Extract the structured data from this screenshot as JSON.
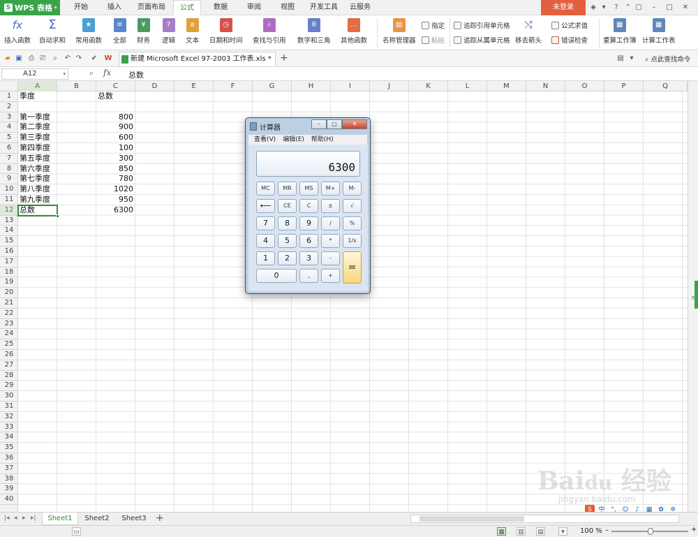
{
  "app": {
    "title": "WPS 表格",
    "login": "未登录"
  },
  "menu_tabs": [
    "开始",
    "插入",
    "页面布局",
    "公式",
    "数据",
    "审阅",
    "视图",
    "开发工具",
    "云服务"
  ],
  "ribbon": {
    "insert_function": "插入函数",
    "autosum": "自动求和",
    "common_func": "常用函数",
    "all": "全部",
    "finance": "财务",
    "logic": "逻辑",
    "text": "文本",
    "datetime": "日期和时间",
    "lookup": "查找与引用",
    "math": "数学和三角",
    "other": "其他函数",
    "name_manager": "名称管理器",
    "specify": "指定",
    "paste": "粘贴",
    "trace_prec": "追踪引用单元格",
    "trace_dep": "追踪从属单元格",
    "remove_arrows": "移去箭头",
    "show_formulas": "公式求值",
    "error_check": "错误检查",
    "recalc_book": "重算工作簿",
    "calc_sheet": "计算工作表"
  },
  "doc": {
    "tab": "新建 Microsoft Excel 97-2003 工作表.xls *",
    "find": "点此查找命令"
  },
  "formula_bar": {
    "name_box": "A12",
    "fx": "fx",
    "value": "总数"
  },
  "columns": [
    "A",
    "B",
    "C",
    "D",
    "E",
    "F",
    "G",
    "H",
    "I",
    "J",
    "K",
    "L",
    "M",
    "N",
    "O",
    "P",
    "Q"
  ],
  "rows": [
    "1",
    "2",
    "3",
    "4",
    "5",
    "6",
    "7",
    "8",
    "9",
    "10",
    "11",
    "12",
    "13",
    "14",
    "15",
    "16",
    "17",
    "18",
    "19",
    "20",
    "21",
    "22",
    "23",
    "24",
    "25",
    "26",
    "27",
    "28",
    "29",
    "30",
    "31",
    "32",
    "33",
    "34",
    "35",
    "36",
    "37",
    "38",
    "39",
    "40"
  ],
  "sheet": {
    "header": {
      "a": "季度",
      "c": "总数"
    },
    "data": [
      {
        "a": "第一季度",
        "c": "800"
      },
      {
        "a": "第二季度",
        "c": "900"
      },
      {
        "a": "第三季度",
        "c": "600"
      },
      {
        "a": "第四季度",
        "c": "100"
      },
      {
        "a": "第五季度",
        "c": "300"
      },
      {
        "a": "第六季度",
        "c": "850"
      },
      {
        "a": "第七季度",
        "c": "780"
      },
      {
        "a": "第八季度",
        "c": "1020"
      },
      {
        "a": "第九季度",
        "c": "950"
      }
    ],
    "total": {
      "a": "总数",
      "c": "6300"
    }
  },
  "sheets": [
    "Sheet1",
    "Sheet2",
    "Sheet3"
  ],
  "status": {
    "zoom": "100 %"
  },
  "calculator": {
    "title": "计算器",
    "menus": [
      "查看(V)",
      "编辑(E)",
      "帮助(H)"
    ],
    "display": "6300",
    "keys": {
      "mc": "MC",
      "mr": "MR",
      "ms": "MS",
      "mplus": "M+",
      "mminus": "M-",
      "back": "⟵",
      "ce": "CE",
      "c": "C",
      "pm": "±",
      "sqrt": "√",
      "k7": "7",
      "k8": "8",
      "k9": "9",
      "div": "/",
      "pct": "%",
      "k4": "4",
      "k5": "5",
      "k6": "6",
      "mul": "*",
      "recip": "1/x",
      "k1": "1",
      "k2": "2",
      "k3": "3",
      "sub": "-",
      "eq": "=",
      "k0": "0",
      "dot": ".",
      "add": "+"
    }
  },
  "watermark": {
    "logo": "Bai du 经验",
    "url": "jingyan.baidu.com"
  }
}
